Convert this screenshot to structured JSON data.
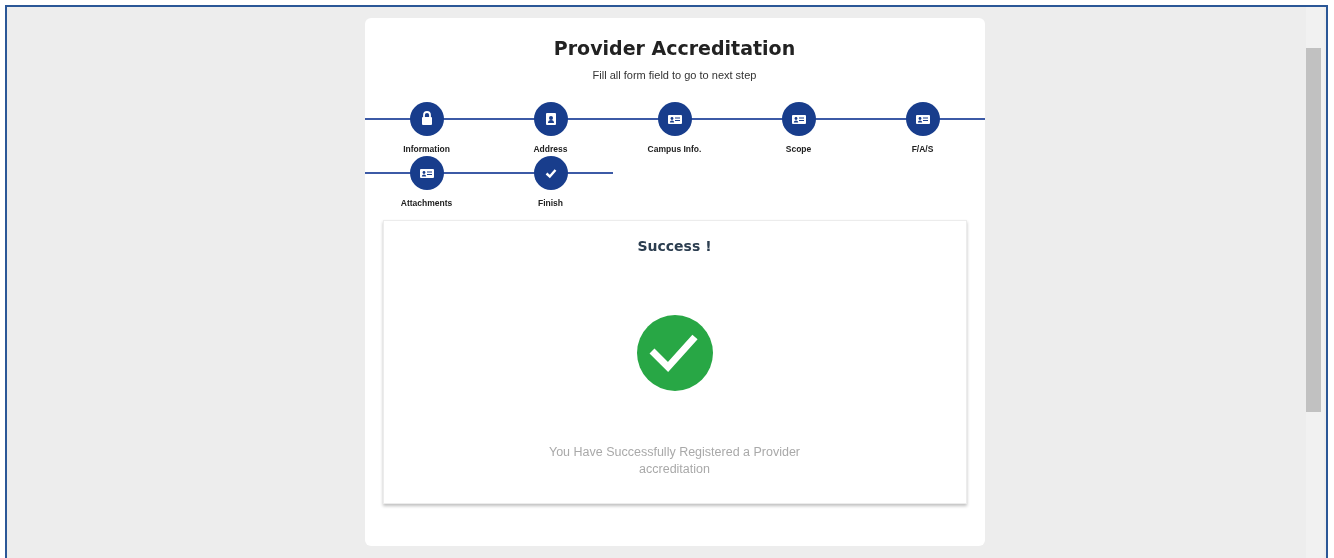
{
  "header": {
    "title": "Provider Accreditation",
    "subtitle": "Fill all form field to go to next step"
  },
  "steps": [
    {
      "label": "Information",
      "kind": "lock"
    },
    {
      "label": "Address",
      "kind": "contact"
    },
    {
      "label": "Campus Info.",
      "kind": "card"
    },
    {
      "label": "Scope",
      "kind": "card"
    },
    {
      "label": "F/A/S",
      "kind": "card"
    },
    {
      "label": "Attachments",
      "kind": "card"
    },
    {
      "label": "Finish",
      "kind": "check"
    }
  ],
  "result": {
    "title": "Success !",
    "message": "You Have Successfully Registered a Provider accreditation"
  }
}
